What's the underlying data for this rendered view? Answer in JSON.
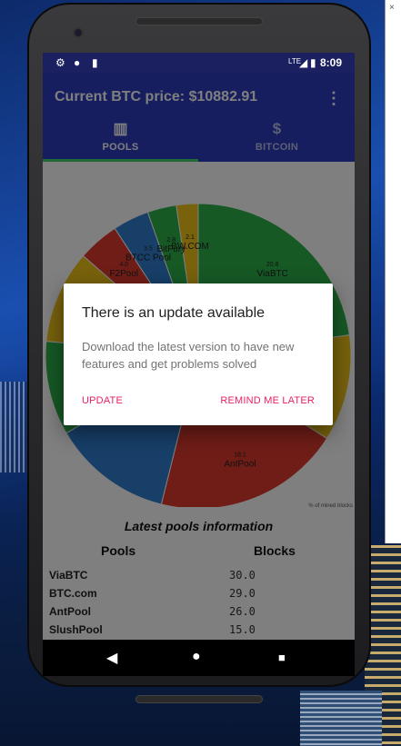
{
  "status_bar": {
    "time": "8:09",
    "network": "LTE",
    "icons": [
      "gear-icon",
      "circle-icon",
      "sd-card-icon",
      "signal-icon",
      "battery-icon"
    ]
  },
  "app_bar": {
    "title": "Current BTC price: $10882.91",
    "overflow_icon": "more-vert-icon",
    "tabs": [
      {
        "label": "POOLS",
        "icon": "bar-chart-icon",
        "glyph": "▥",
        "selected": true
      },
      {
        "label": "BITCOIN",
        "icon": "dollar-icon",
        "glyph": "$",
        "selected": false
      }
    ]
  },
  "chart_data": {
    "type": "pie",
    "donut": true,
    "description_label": "% of mined blocks",
    "slices": [
      {
        "label": "ViaBTC",
        "value": 20.8,
        "color": "#2db34a"
      },
      {
        "label": "",
        "value": 10.3,
        "color": "#f0c419"
      },
      {
        "label": "AntPool",
        "value": 18.1,
        "color": "#e03a2f"
      },
      {
        "label": "",
        "value": 11.6,
        "color": "#2f7fd0"
      },
      {
        "label": "",
        "value": 9.1,
        "color": "#2db34a"
      },
      {
        "label": "Unknown",
        "value": 9.0,
        "color": "#f0c419"
      },
      {
        "label": "F2Pool",
        "value": 4.0,
        "color": "#e03a2f"
      },
      {
        "label": "BTCC Pool",
        "value": 3.5,
        "color": "#2f7fd0"
      },
      {
        "label": "BitFury",
        "value": 2.8,
        "color": "#2db34a"
      },
      {
        "label": "BW.COM",
        "value": 2.1,
        "color": "#f0c419"
      }
    ],
    "visible_values": [
      "20.8",
      "18.1",
      "9.0",
      "3.5",
      "2.8",
      "2.1"
    ]
  },
  "latest": {
    "title": "Latest pools information",
    "col_pools": "Pools",
    "col_blocks": "Blocks",
    "rows": [
      {
        "pool": "ViaBTC",
        "blocks": "30.0"
      },
      {
        "pool": "BTC.com",
        "blocks": "29.0"
      },
      {
        "pool": "AntPool",
        "blocks": "26.0"
      },
      {
        "pool": "SlushPool",
        "blocks": "15.0"
      }
    ]
  },
  "dialog": {
    "title": "There is an update available",
    "message": "Download the latest version to have new features and get problems solved",
    "positive_button": "UPDATE",
    "negative_button": "REMIND ME LATER"
  },
  "nav_bar": {
    "back": "◀",
    "home": "●",
    "recents": "■"
  },
  "background_window": {
    "close_glyph": "×"
  }
}
